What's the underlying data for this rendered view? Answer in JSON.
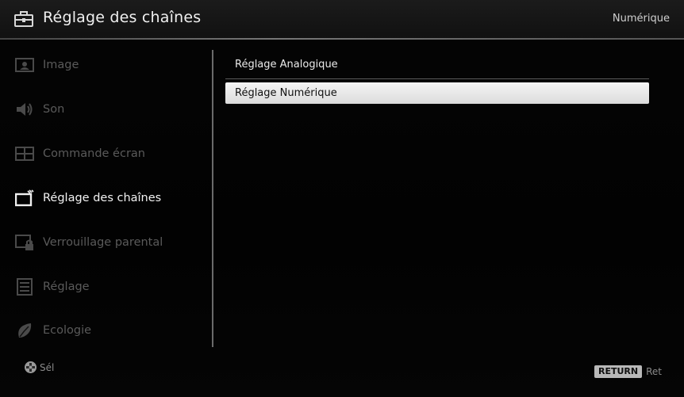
{
  "header": {
    "title": "Réglage des chaînes",
    "mode": "Numérique"
  },
  "sidebar": {
    "items": [
      {
        "label": "Image",
        "icon": "image-icon",
        "active": false
      },
      {
        "label": "Son",
        "icon": "speaker-icon",
        "active": false
      },
      {
        "label": "Commande écran",
        "icon": "screen-control-icon",
        "active": false
      },
      {
        "label": "Réglage des chaînes",
        "icon": "channel-setup-icon",
        "active": true
      },
      {
        "label": "Verrouillage parental",
        "icon": "parental-lock-icon",
        "active": false
      },
      {
        "label": "Réglage",
        "icon": "settings-icon",
        "active": false
      },
      {
        "label": "Ecologie",
        "icon": "eco-leaf-icon",
        "active": false
      }
    ]
  },
  "panel": {
    "options": [
      {
        "label": "Réglage Analogique",
        "selected": false
      },
      {
        "label": "Réglage Numérique",
        "selected": true
      }
    ]
  },
  "footer": {
    "select_label": "Sél",
    "return_key": "RETURN",
    "return_label": "Ret"
  },
  "colors": {
    "background": "#000000",
    "active_text": "#f2f2f2",
    "inactive_text": "#5a5a5a",
    "highlight": "#e6e6e6"
  }
}
